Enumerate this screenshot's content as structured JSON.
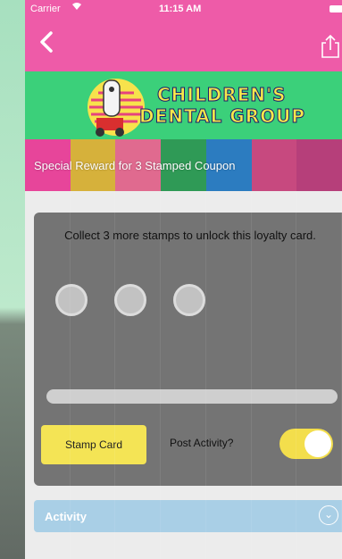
{
  "status_bar": {
    "carrier": "Carrier",
    "wifi_icon": "wifi-icon",
    "time": "11:15 AM"
  },
  "nav": {
    "back_icon": "chevron-left-icon",
    "share_icon": "share-icon"
  },
  "logo": {
    "line1": "CHILDREN'S",
    "line2": "DENTAL GROUP"
  },
  "banner": {
    "text": "Special Reward for 3 Stamped Coupon",
    "stripe_colors": [
      "#e7459a",
      "#d6b13b",
      "#e06a8f",
      "#2f9a56",
      "#2c7cc0",
      "#c7497f",
      "#b63f7a"
    ]
  },
  "card": {
    "message": "Collect 3 more stamps to unlock this loyalty card.",
    "stamps_collected": 0,
    "stamps_total": 3,
    "progress": 0,
    "stamp_button": "Stamp Card",
    "post_activity_label": "Post Activity?",
    "post_activity_on": true
  },
  "activity": {
    "label": "Activity",
    "icon": "chevron-down-icon"
  },
  "colors": {
    "pink": "#ee5ba8",
    "green": "#3bd07a",
    "card": "#747474",
    "yellow": "#f4e455",
    "activity": "#a9cfe6"
  }
}
